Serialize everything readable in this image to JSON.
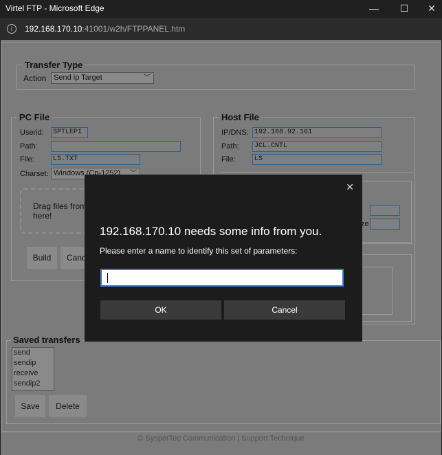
{
  "window": {
    "title": "Virtel FTP - Microsoft Edge",
    "minimize": "—",
    "maximize": "☐",
    "close": "✕"
  },
  "address": {
    "host": "192.168.170.10",
    "path": ":41001/w2h/FTPPANEL.htm",
    "info_icon": "i"
  },
  "transfer_type": {
    "legend": "Transfer Type",
    "action_label": "Action",
    "action_value": "Send ip Target"
  },
  "pc_file": {
    "legend": "PC File",
    "userid_label": "Userid:",
    "userid_value": "SPTLEPI",
    "path_label": "Path:",
    "path_value": "",
    "file_label": "File:",
    "file_value": "LS.TXT",
    "charset_label": "Charset:",
    "charset_value": "Windows (Cp-1252)",
    "dropzone_text_1": "Drag files from",
    "dropzone_text_2": "here!",
    "build_button": "Build",
    "cancel_button": "Canc"
  },
  "host_file": {
    "legend": "Host File",
    "ip_label": "IP/DNS:",
    "ip_value": "192.168.92.161",
    "path_label": "Path:",
    "path_value": "JCL.CNTL",
    "file_label": "File:",
    "file_value": "LS",
    "partial_label": "ze"
  },
  "saved": {
    "legend": "Saved transfers",
    "items": [
      "send",
      "sendip",
      "receive",
      "sendip2"
    ],
    "save_button": "Save",
    "delete_button": "Delete"
  },
  "footer": "© SysperTec Communication | Support Technique",
  "dialog": {
    "close": "✕",
    "heading": "192.168.170.10 needs some info from you.",
    "prompt": "Please enter a name to identify this set of parameters:",
    "input_value": "",
    "ok": "OK",
    "cancel": "Cancel"
  },
  "colors": {
    "accent": "#3a7bd5",
    "dialog_bg": "#1c1c1c",
    "page_dim": "#7b7b7b"
  }
}
